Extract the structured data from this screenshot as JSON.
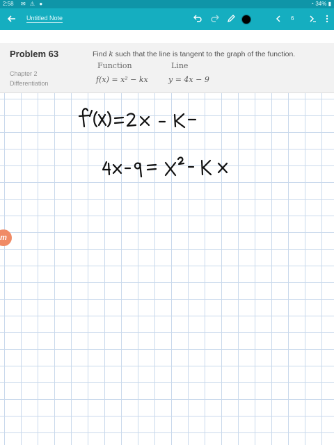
{
  "status_bar": {
    "time": "2:58",
    "battery": "34%"
  },
  "toolbar": {
    "title": "Untitled Note",
    "page_number": "6"
  },
  "problem": {
    "title": "Problem 63",
    "chapter": "Chapter 2",
    "section": "Differentiation",
    "question_prefix": "Find ",
    "question_var": "k",
    "question_suffix": " such that the line is tangent to the graph of the function.",
    "column_function": "Function",
    "column_line": "Line",
    "function_expr": "f(x) = x² − kx",
    "line_expr": "y = 4x − 9"
  },
  "side_badge": "m"
}
